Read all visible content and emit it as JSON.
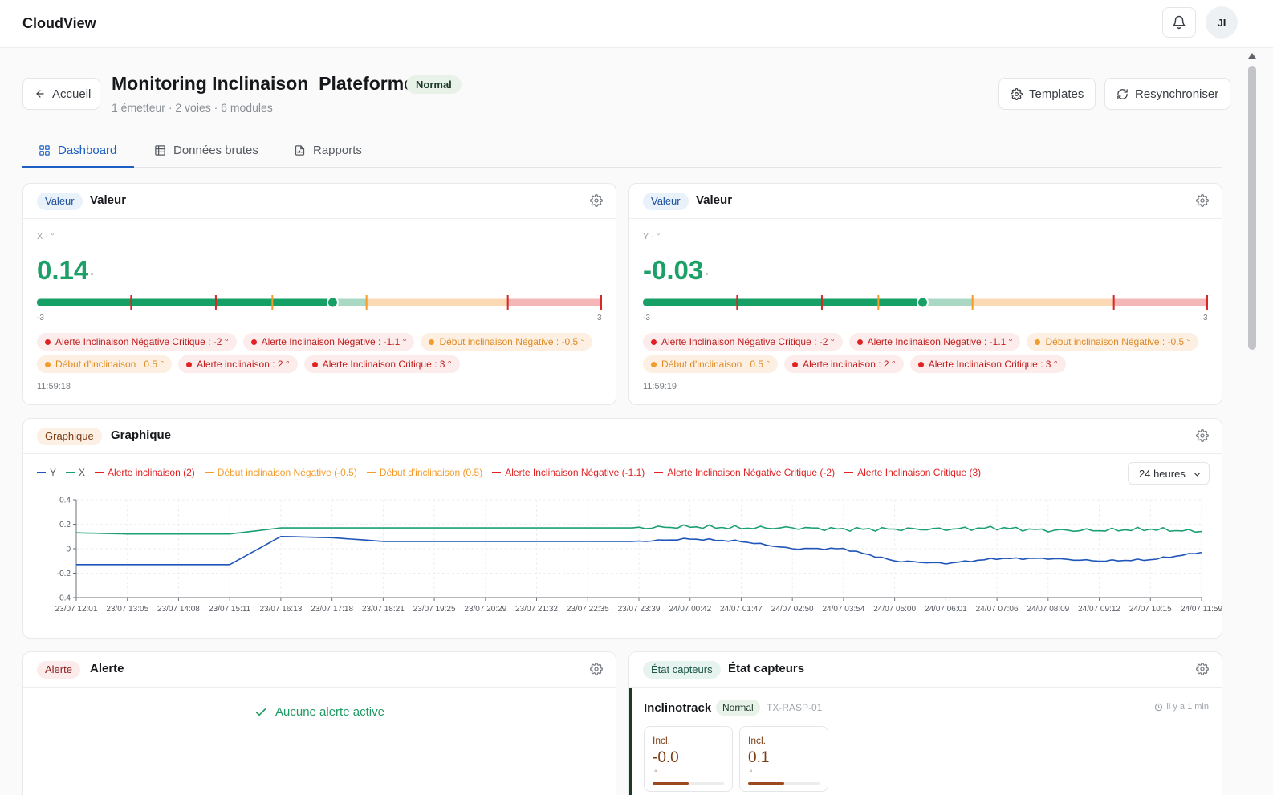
{
  "app": {
    "brand": "CloudView",
    "user_initials": "JI"
  },
  "header": {
    "back_label": "Accueil",
    "title": "Monitoring Inclinaison  Plateforme",
    "status_badge": "Normal",
    "subtitle": "1 émetteur · 2 voies · 6 modules",
    "templates_label": "Templates",
    "resync_label": "Resynchroniser"
  },
  "tabs": [
    {
      "label": "Dashboard",
      "icon": "grid-icon",
      "active": true
    },
    {
      "label": "Données brutes",
      "icon": "table-icon",
      "active": false
    },
    {
      "label": "Rapports",
      "icon": "report-icon",
      "active": false
    }
  ],
  "colors": {
    "accent": "#1d5fc4",
    "value_green": "#1ca067",
    "alert_red": "#e02222",
    "warning_orange": "#f39b2b",
    "series_y": "#1f55b8",
    "series_x": "#1ca070"
  },
  "value_cards": [
    {
      "chip": "Valeur",
      "title": "Valeur",
      "axis_label": "X · °",
      "value": "0.14",
      "unit": "°",
      "min_label": "-3",
      "max_label": "3",
      "level": 0.14,
      "timestamp": "11:59:18",
      "thresholds": [
        {
          "label": "Alerte Inclinaison Négative Critique : -2 °",
          "level": "red"
        },
        {
          "label": "Alerte Inclinaison Négative : -1.1 °",
          "level": "red"
        },
        {
          "label": "Début inclinaison Négative : -0.5 °",
          "level": "orange"
        },
        {
          "label": "Début d'inclinaison : 0.5 °",
          "level": "orange"
        },
        {
          "label": "Alerte inclinaison : 2 °",
          "level": "red"
        },
        {
          "label": "Alerte Inclinaison Critique : 3 °",
          "level": "red"
        }
      ]
    },
    {
      "chip": "Valeur",
      "title": "Valeur",
      "axis_label": "Y · °",
      "value": "-0.03",
      "unit": "°",
      "min_label": "-3",
      "max_label": "3",
      "level": -0.03,
      "timestamp": "11:59:19",
      "thresholds": [
        {
          "label": "Alerte Inclinaison Négative Critique : -2 °",
          "level": "red"
        },
        {
          "label": "Alerte Inclinaison Négative : -1.1 °",
          "level": "red"
        },
        {
          "label": "Début inclinaison Négative : -0.5 °",
          "level": "orange"
        },
        {
          "label": "Début d'inclinaison : 0.5 °",
          "level": "orange"
        },
        {
          "label": "Alerte inclinaison : 2 °",
          "level": "red"
        },
        {
          "label": "Alerte Inclinaison Critique : 3 °",
          "level": "red"
        }
      ]
    }
  ],
  "graph_card": {
    "chip": "Graphique",
    "title": "Graphique",
    "range_value": "24 heures",
    "legend": [
      {
        "label": "Y",
        "color": "#1f55b8"
      },
      {
        "label": "X",
        "color": "#1ca070"
      },
      {
        "label": "Alerte inclinaison (2)",
        "color": "#e02222"
      },
      {
        "label": "Début inclinaison Négative (-0.5)",
        "color": "#f39b2b"
      },
      {
        "label": "Début d'inclinaison (0.5)",
        "color": "#f39b2b"
      },
      {
        "label": "Alerte Inclinaison Négative (-1.1)",
        "color": "#e02222"
      },
      {
        "label": "Alerte Inclinaison Négative Critique (-2)",
        "color": "#e02222"
      },
      {
        "label": "Alerte Inclinaison Critique (3)",
        "color": "#e02222"
      }
    ]
  },
  "chart_data": {
    "type": "line",
    "title": "Graphique",
    "xlabel": "",
    "ylabel": "",
    "ylim": [
      -0.4,
      0.4
    ],
    "yticks": [
      0.4,
      0.2,
      0,
      -0.2,
      -0.4
    ],
    "grid": true,
    "legend_position": "top-left",
    "x": [
      "23/07 12:01",
      "23/07 13:05",
      "23/07 14:08",
      "23/07 15:11",
      "23/07 16:13",
      "23/07 17:18",
      "23/07 18:21",
      "23/07 19:25",
      "23/07 20:29",
      "23/07 21:32",
      "23/07 22:35",
      "23/07 23:39",
      "24/07 00:42",
      "24/07 01:47",
      "24/07 02:50",
      "24/07 03:54",
      "24/07 05:00",
      "24/07 06:01",
      "24/07 07:06",
      "24/07 08:09",
      "24/07 09:12",
      "24/07 10:15",
      "24/07 11:59"
    ],
    "series": [
      {
        "name": "Y",
        "color": "#1f55b8",
        "values": [
          -0.13,
          -0.13,
          -0.13,
          -0.13,
          0.1,
          0.09,
          0.06,
          0.06,
          0.06,
          0.06,
          0.06,
          0.06,
          0.08,
          0.06,
          0,
          0,
          -0.1,
          -0.12,
          -0.08,
          -0.08,
          -0.1,
          -0.09,
          -0.03
        ]
      },
      {
        "name": "X",
        "color": "#1ca070",
        "values": [
          0.13,
          0.12,
          0.12,
          0.12,
          0.17,
          0.17,
          0.17,
          0.17,
          0.17,
          0.17,
          0.17,
          0.17,
          0.18,
          0.17,
          0.17,
          0.16,
          0.16,
          0.16,
          0.17,
          0.15,
          0.15,
          0.16,
          0.14
        ]
      }
    ]
  },
  "alert_card": {
    "chip": "Alerte",
    "title": "Alerte",
    "empty_message": "Aucune alerte active"
  },
  "sensor_card": {
    "chip": "État capteurs",
    "title": "État capteurs",
    "sensor": {
      "name": "Inclinotrack",
      "status": "Normal",
      "id": "TX-RASP-01",
      "last_seen": "il y a 1 min",
      "modules": [
        {
          "label": "Incl.",
          "value": "-0.0",
          "unit": "°",
          "level": 0.5
        },
        {
          "label": "Incl.",
          "value": "0.1",
          "unit": "°",
          "level": 0.5
        }
      ]
    }
  }
}
